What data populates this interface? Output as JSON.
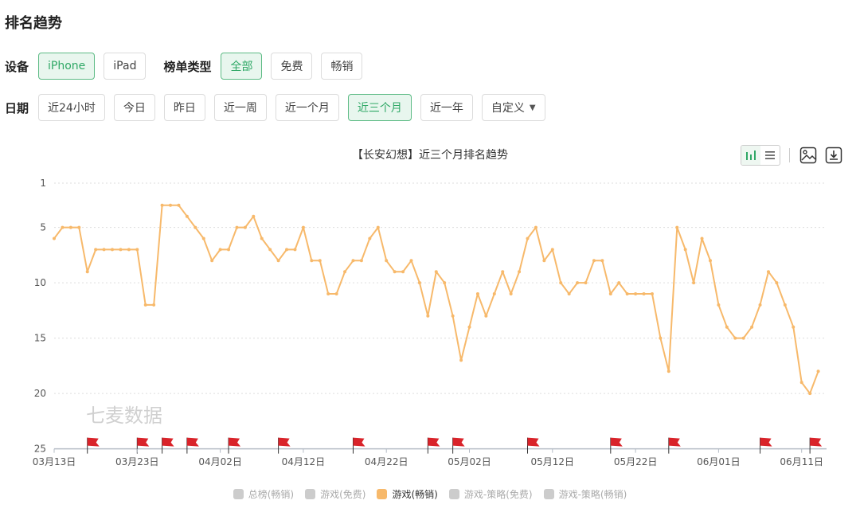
{
  "page": {
    "title": "排名趋势"
  },
  "filters": {
    "device_label": "设备",
    "devices": [
      {
        "label": "iPhone",
        "active": true
      },
      {
        "label": "iPad",
        "active": false
      }
    ],
    "list_type_label": "榜单类型",
    "list_types": [
      {
        "label": "全部",
        "active": true
      },
      {
        "label": "免费",
        "active": false
      },
      {
        "label": "畅销",
        "active": false
      }
    ],
    "date_label": "日期",
    "dates": [
      {
        "label": "近24小时",
        "active": false
      },
      {
        "label": "今日",
        "active": false
      },
      {
        "label": "昨日",
        "active": false
      },
      {
        "label": "近一周",
        "active": false
      },
      {
        "label": "近一个月",
        "active": false
      },
      {
        "label": "近三个月",
        "active": true
      },
      {
        "label": "近一年",
        "active": false
      },
      {
        "label": "自定义",
        "active": false,
        "dropdown": true
      }
    ]
  },
  "toolbar": {
    "icons": [
      "bar-chart-icon",
      "list-icon",
      "image-icon",
      "download-icon"
    ],
    "active_color": "#2fa866"
  },
  "watermark": "七麦数据",
  "chart_data": {
    "type": "line",
    "title": "【长安幻想】近三个月排名趋势",
    "y_inverted": true,
    "ylim": [
      1,
      25
    ],
    "y_ticks": [
      1,
      5,
      10,
      15,
      20,
      25
    ],
    "x_tick_labels": [
      "03月13日",
      "03月23日",
      "04月02日",
      "04月12日",
      "04月22日",
      "05月02日",
      "05月12日",
      "05月22日",
      "06月01日",
      "06月11日"
    ],
    "x_range": [
      "03月13日",
      "06月12日"
    ],
    "grid": true,
    "legend_position": "bottom",
    "series": [
      {
        "name": "游戏(畅销)",
        "color": "#f7b96b",
        "visible": true,
        "values": [
          6,
          5,
          5,
          5,
          9,
          7,
          7,
          7,
          7,
          7,
          7,
          12,
          12,
          3,
          3,
          3,
          4,
          5,
          6,
          8,
          7,
          7,
          5,
          5,
          4,
          6,
          7,
          8,
          7,
          7,
          5,
          8,
          8,
          11,
          11,
          9,
          8,
          8,
          6,
          5,
          8,
          9,
          9,
          8,
          10,
          13,
          9,
          10,
          13,
          17,
          14,
          11,
          13,
          11,
          9,
          11,
          9,
          6,
          5,
          8,
          7,
          10,
          11,
          10,
          10,
          8,
          8,
          11,
          10,
          11,
          11,
          11,
          11,
          15,
          18,
          5,
          7,
          10,
          6,
          8,
          12,
          14,
          15,
          15,
          14,
          12,
          9,
          10,
          12,
          14,
          19,
          20,
          18
        ]
      },
      {
        "name": "总榜(畅销)",
        "color": "#cccccc",
        "visible": false,
        "values": []
      },
      {
        "name": "游戏(免费)",
        "color": "#cccccc",
        "visible": false,
        "values": []
      },
      {
        "name": "游戏-策略(免费)",
        "color": "#cccccc",
        "visible": false,
        "values": []
      },
      {
        "name": "游戏-策略(畅销)",
        "color": "#cccccc",
        "visible": false,
        "values": []
      }
    ],
    "event_flag_days": [
      4,
      10,
      13,
      16,
      21,
      27,
      36,
      45,
      48,
      57,
      67,
      74,
      85,
      91
    ],
    "event_flag_color": "#d9232a"
  },
  "legend": [
    "总榜(畅销)",
    "游戏(免费)",
    "游戏(畅销)",
    "游戏-策略(免费)",
    "游戏-策略(畅销)"
  ],
  "legend_active": "游戏(畅销)"
}
